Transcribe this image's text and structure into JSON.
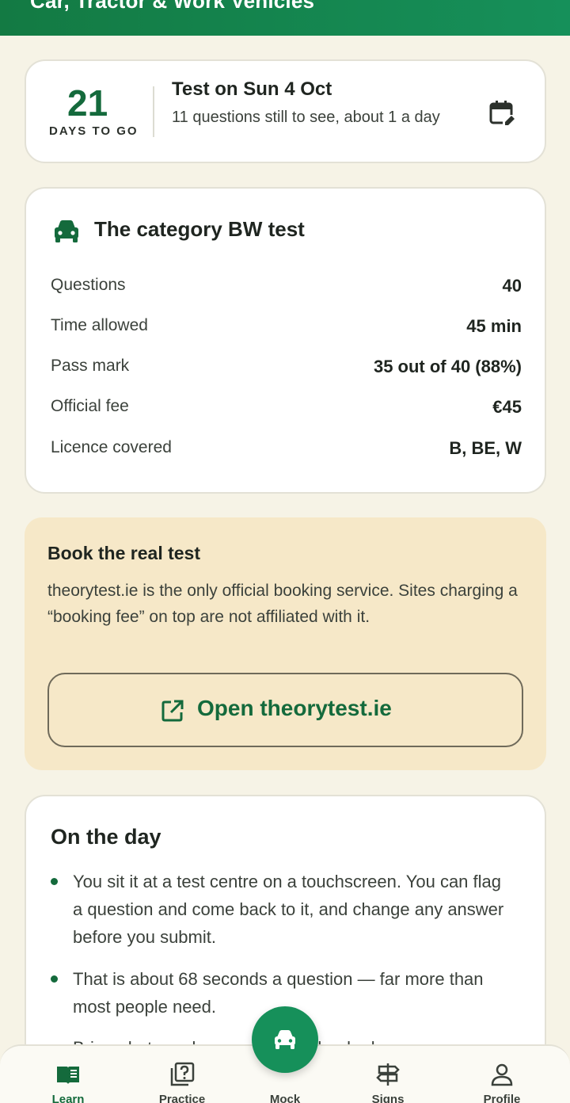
{
  "header": {
    "title": "Car, Tractor & Work Vehicles"
  },
  "countdown": {
    "days": "21",
    "days_label": "DAYS TO GO",
    "test_date": "Test on Sun 4 Oct",
    "subtitle": "11 questions still to see, about 1 a day",
    "icon": "calendar-edit-icon"
  },
  "category": {
    "title": "The category BW test",
    "icon": "car-icon",
    "rows": [
      {
        "label": "Questions",
        "value": "40"
      },
      {
        "label": "Time allowed",
        "value": "45 min"
      },
      {
        "label": "Pass mark",
        "value": "35 out of 40 (88%)"
      },
      {
        "label": "Official fee",
        "value": "€45"
      },
      {
        "label": "Licence covered",
        "value": "B, BE, W"
      }
    ]
  },
  "booking": {
    "title": "Book the real test",
    "body": "theorytest.ie is the only official booking service. Sites charging a “booking fee” on top are not affiliated with it.",
    "button_label": "Open theorytest.ie",
    "button_icon": "external-link-icon"
  },
  "on_the_day": {
    "title": "On the day",
    "bullets": [
      "You sit it at a test centre on a touchscreen. You can flag a question and come back to it, and change any answer before you submit.",
      "That is about 68 seconds a question — far more than most people need.",
      "Bring photo and ... your PPS ... booked"
    ]
  },
  "nav": {
    "items": [
      {
        "label": "Learn",
        "icon": "book-icon",
        "active": true
      },
      {
        "label": "Practice",
        "icon": "question-icon",
        "active": false
      },
      {
        "label": "Mock",
        "icon": "car-icon",
        "active": false
      },
      {
        "label": "Signs",
        "icon": "signpost-icon",
        "active": false
      },
      {
        "label": "Profile",
        "icon": "person-icon",
        "active": false
      }
    ]
  },
  "colors": {
    "brand_green": "#146a3c",
    "header_green": "#137a43",
    "background": "#f6f3e6",
    "booking_bg": "#f6e8c8"
  }
}
